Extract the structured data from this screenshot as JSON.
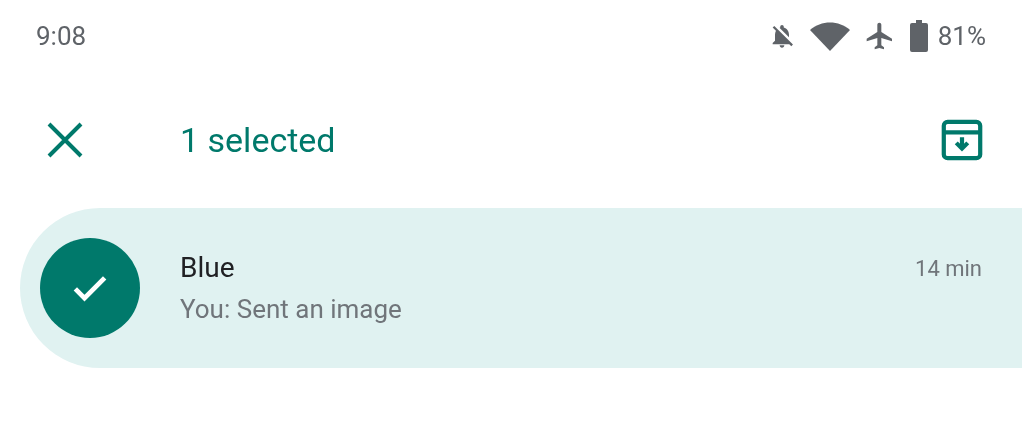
{
  "status_bar": {
    "time": "9:08",
    "battery": "81%"
  },
  "toolbar": {
    "title": "1 selected"
  },
  "conversations": [
    {
      "name": "Blue",
      "snippet": "You: Sent an image",
      "time": "14 min",
      "selected": true
    }
  ]
}
